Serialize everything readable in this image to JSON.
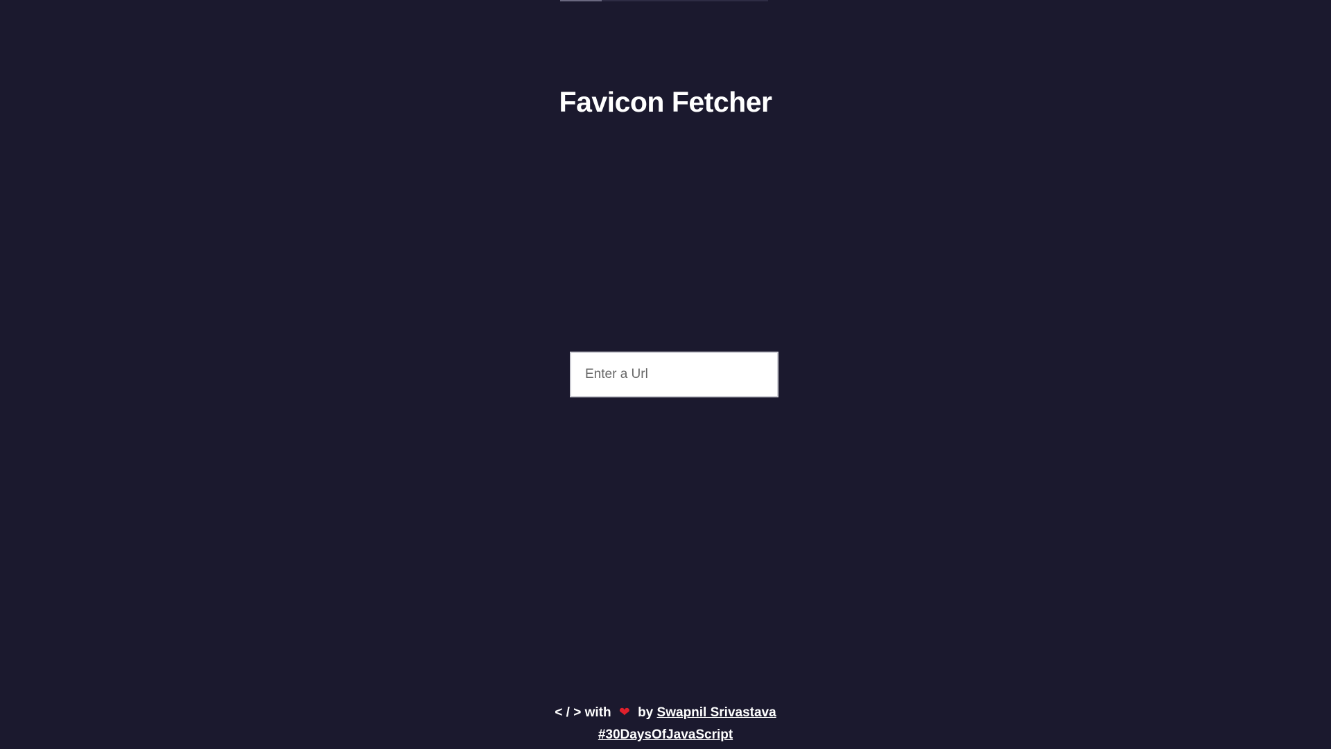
{
  "header": {
    "title": "Favicon Fetcher",
    "progress_fraction": 0.2
  },
  "form": {
    "url_placeholder": "Enter a Url",
    "url_value": ""
  },
  "footer": {
    "code_symbol": "< / >",
    "with_text": "with",
    "heart_icon": "heart-icon",
    "by_text": "by",
    "author_link": "Swapnil Srivastava",
    "hashtag_link": "#30DaysOfJavaScript"
  },
  "colors": {
    "background": "#1b192e",
    "text": "#ffffff",
    "heart": "#e0202c",
    "input_background": "#ffffff"
  }
}
